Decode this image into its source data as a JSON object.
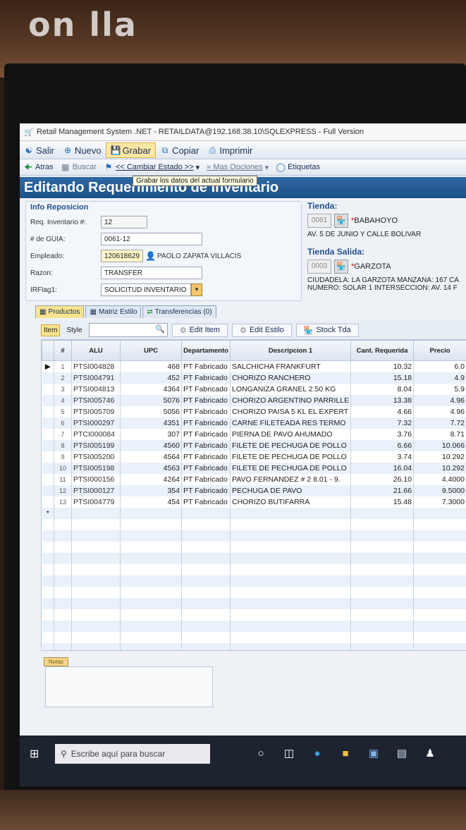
{
  "window": {
    "title": "Retail Management System .NET - RETAILDATA@192.168.38.10\\SQLEXPRESS - Full Version"
  },
  "toolbar1": [
    {
      "label": "Salir",
      "icon": "exit-icon",
      "hover": false
    },
    {
      "label": "Nuevo",
      "icon": "plus-circle-icon",
      "hover": false
    },
    {
      "label": "Grabar",
      "icon": "save-icon",
      "hover": true
    },
    {
      "label": "Copiar",
      "icon": "copy-icon",
      "hover": false
    },
    {
      "label": "Imprimir",
      "icon": "printer-icon",
      "hover": false
    }
  ],
  "toolbar2": [
    {
      "label": "Atras",
      "icon": "back-arrow-icon",
      "dim": false
    },
    {
      "label": "Buscar",
      "icon": "search-grid-icon",
      "dim": true
    },
    {
      "label": "<< Cambiar Estado >>",
      "icon": "flag-icon",
      "dim": false
    },
    {
      "label": "» Mas Opciones",
      "icon": "",
      "dim": true
    },
    {
      "label": "Etiquetas",
      "icon": "tag-icon",
      "dim": false
    }
  ],
  "tooltip": "Grabar los datos del actual formulario",
  "header": "Editando Requerimiento de Inventario",
  "info": {
    "legend": "Info Reposicion",
    "req_label": "Req. Inventario #:",
    "req_value": "12",
    "guia_label": "# de GUIA:",
    "guia_value": "0061-12",
    "empleado_label": "Empleado:",
    "empleado_value": "120618629",
    "empleado_name": "PAOLO ZAPATA VILLACIS",
    "razon_label": "Razon:",
    "razon_value": "TRANSFER",
    "irflag_label": "IRFlag1:",
    "irflag_value": "SOLICITUD INVENTARIO"
  },
  "tienda": {
    "label": "Tienda:",
    "code": "0061",
    "name": "BABAHOYO",
    "address": "AV. 5 DE JUNIO Y CALLE BOLIVAR"
  },
  "tienda_salida": {
    "label": "Tienda Salida:",
    "code": "0003",
    "name": "GARZOTA",
    "address1": "CIUDADELA: LA GARZOTA MANZANA: 167 CA",
    "address2": "NUMERO: SOLAR 1 INTERSECCION: AV. 14 F"
  },
  "tabs": [
    "Productos",
    "Matriz Estilo",
    "Transferencias (0)"
  ],
  "subbar": {
    "item": "Item",
    "style": "Style",
    "edit_item": "Edit Item",
    "edit_estilo": "Edit Estilo",
    "stock": "Stock Tda"
  },
  "table": {
    "columns": [
      "#",
      "ALU",
      "UPC",
      "Departamento",
      "Descripcion 1",
      "Cant. Requerida",
      "Precio"
    ],
    "rows": [
      {
        "n": "1",
        "alu": "PTSI004828",
        "upc": "468",
        "dep": "PT Fabricado",
        "desc": "SALCHICHA FRANKFURT",
        "cant": "10.32",
        "precio": "6.0"
      },
      {
        "n": "2",
        "alu": "PTSI004791",
        "upc": "452",
        "dep": "PT Fabricado",
        "desc": "CHORIZO RANCHERO",
        "cant": "15.18",
        "precio": "4.9"
      },
      {
        "n": "3",
        "alu": "PTSI004813",
        "upc": "4364",
        "dep": "PT Fabricado",
        "desc": "LONGANIZA GRANEL 2.50 KG",
        "cant": "8.04",
        "precio": "5.9"
      },
      {
        "n": "4",
        "alu": "PTSI005746",
        "upc": "5076",
        "dep": "PT Fabricado",
        "desc": "CHORIZO ARGENTINO PARRILLE",
        "cant": "13.38",
        "precio": "4.96"
      },
      {
        "n": "5",
        "alu": "PTSI005709",
        "upc": "5056",
        "dep": "PT Fabricado",
        "desc": "CHORIZO PAISA 5 KL EL EXPERT",
        "cant": "4.66",
        "precio": "4.96"
      },
      {
        "n": "6",
        "alu": "PTSI000297",
        "upc": "4351",
        "dep": "PT Fabricado",
        "desc": "CARNE FILETEADA RES TERMO",
        "cant": "7.32",
        "precio": "7.72"
      },
      {
        "n": "7",
        "alu": "PTCI000084",
        "upc": "307",
        "dep": "PT Fabricado",
        "desc": "PIERNA DE PAVO AHUMADO",
        "cant": "3.76",
        "precio": "8.71"
      },
      {
        "n": "8",
        "alu": "PTSI005199",
        "upc": "4560",
        "dep": "PT Fabricado",
        "desc": "FILETE DE PECHUGA DE POLLO",
        "cant": "6.66",
        "precio": "10.066"
      },
      {
        "n": "9",
        "alu": "PTSI005200",
        "upc": "4564",
        "dep": "PT Fabricado",
        "desc": "FILETE DE PECHUGA DE POLLO",
        "cant": "3.74",
        "precio": "10.292"
      },
      {
        "n": "10",
        "alu": "PTSI005198",
        "upc": "4563",
        "dep": "PT Fabricado",
        "desc": "FILETE DE PECHUGA DE POLLO",
        "cant": "16.04",
        "precio": "10.292"
      },
      {
        "n": "11",
        "alu": "PTSI000156",
        "upc": "4264",
        "dep": "PT Fabricado",
        "desc": "PAVO FERNANDEZ # 2 8.01 - 9.",
        "cant": "26.10",
        "precio": "4.4000"
      },
      {
        "n": "12",
        "alu": "PTSI000127",
        "upc": "354",
        "dep": "PT Fabricado",
        "desc": "PECHUGA DE PAVO",
        "cant": "21.66",
        "precio": "9.5000"
      },
      {
        "n": "13",
        "alu": "PTSI004779",
        "upc": "454",
        "dep": "PT Fabricado",
        "desc": "CHORIZO BUTIFARRA",
        "cant": "15.48",
        "precio": "7.3000"
      }
    ]
  },
  "notes_tab": "Notas",
  "taskbar": {
    "search_placeholder": "Escribe aquí para buscar"
  },
  "background_sign": "on lla"
}
